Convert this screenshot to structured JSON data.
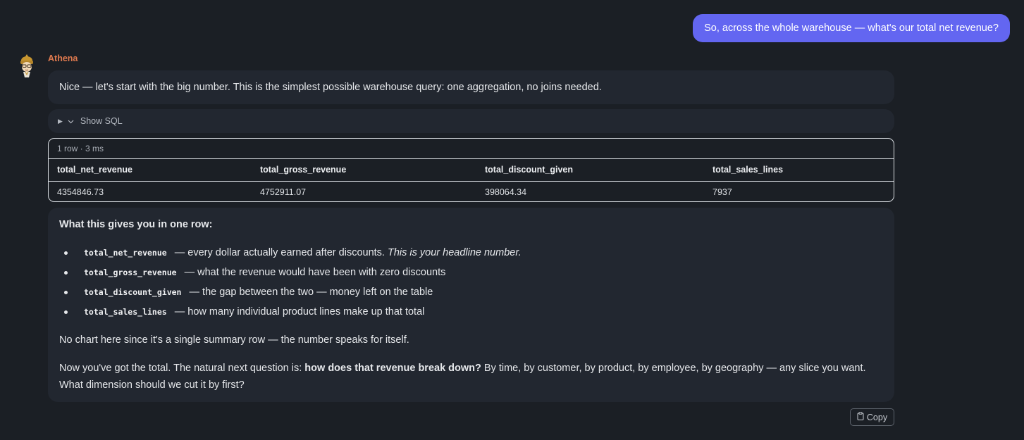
{
  "user_message": "So, across the whole warehouse — what's our total net revenue?",
  "assistant": {
    "name": "Athena",
    "intro": "Nice — let's start with the big number. This is the simplest possible warehouse query: one aggregation, no joins needed.",
    "sql_toggle": {
      "label": "Show SQL"
    },
    "result": {
      "meta": "1 row · 3 ms",
      "columns": [
        "total_net_revenue",
        "total_gross_revenue",
        "total_discount_given",
        "total_sales_lines"
      ],
      "rows": [
        [
          "4354846.73",
          "4752911.07",
          "398064.34",
          "7937"
        ]
      ]
    },
    "explanation": {
      "heading": "What this gives you in one row:",
      "items": [
        {
          "code": "total_net_revenue",
          "text": "— every dollar actually earned after discounts. ",
          "emphasis": "This is your headline number."
        },
        {
          "code": "total_gross_revenue",
          "text": "— what the revenue would have been with zero discounts"
        },
        {
          "code": "total_discount_given",
          "text": "— the gap between the two — money left on the table"
        },
        {
          "code": "total_sales_lines",
          "text": "— how many individual product lines make up that total"
        }
      ],
      "p1": "No chart here since it's a single summary row — the number speaks for itself.",
      "p2_prefix": "Now you've got the total. The natural next question is: ",
      "p2_bold": "how does that revenue break down?",
      "p2_suffix": " By time, by customer, by product, by employee, by geography — any slice you want. What dimension should we cut it by first?"
    },
    "copy_label": "Copy"
  },
  "icons": {
    "avatar": "owl-avatar-icon",
    "toggle": "triangle-right-icon",
    "chevron": "chevron-down-icon",
    "copy": "clipboard-icon"
  },
  "colors": {
    "background": "#1b1f25",
    "card": "#222730",
    "user_bubble": "#6366f1",
    "assistant_name": "#e07a4f"
  }
}
